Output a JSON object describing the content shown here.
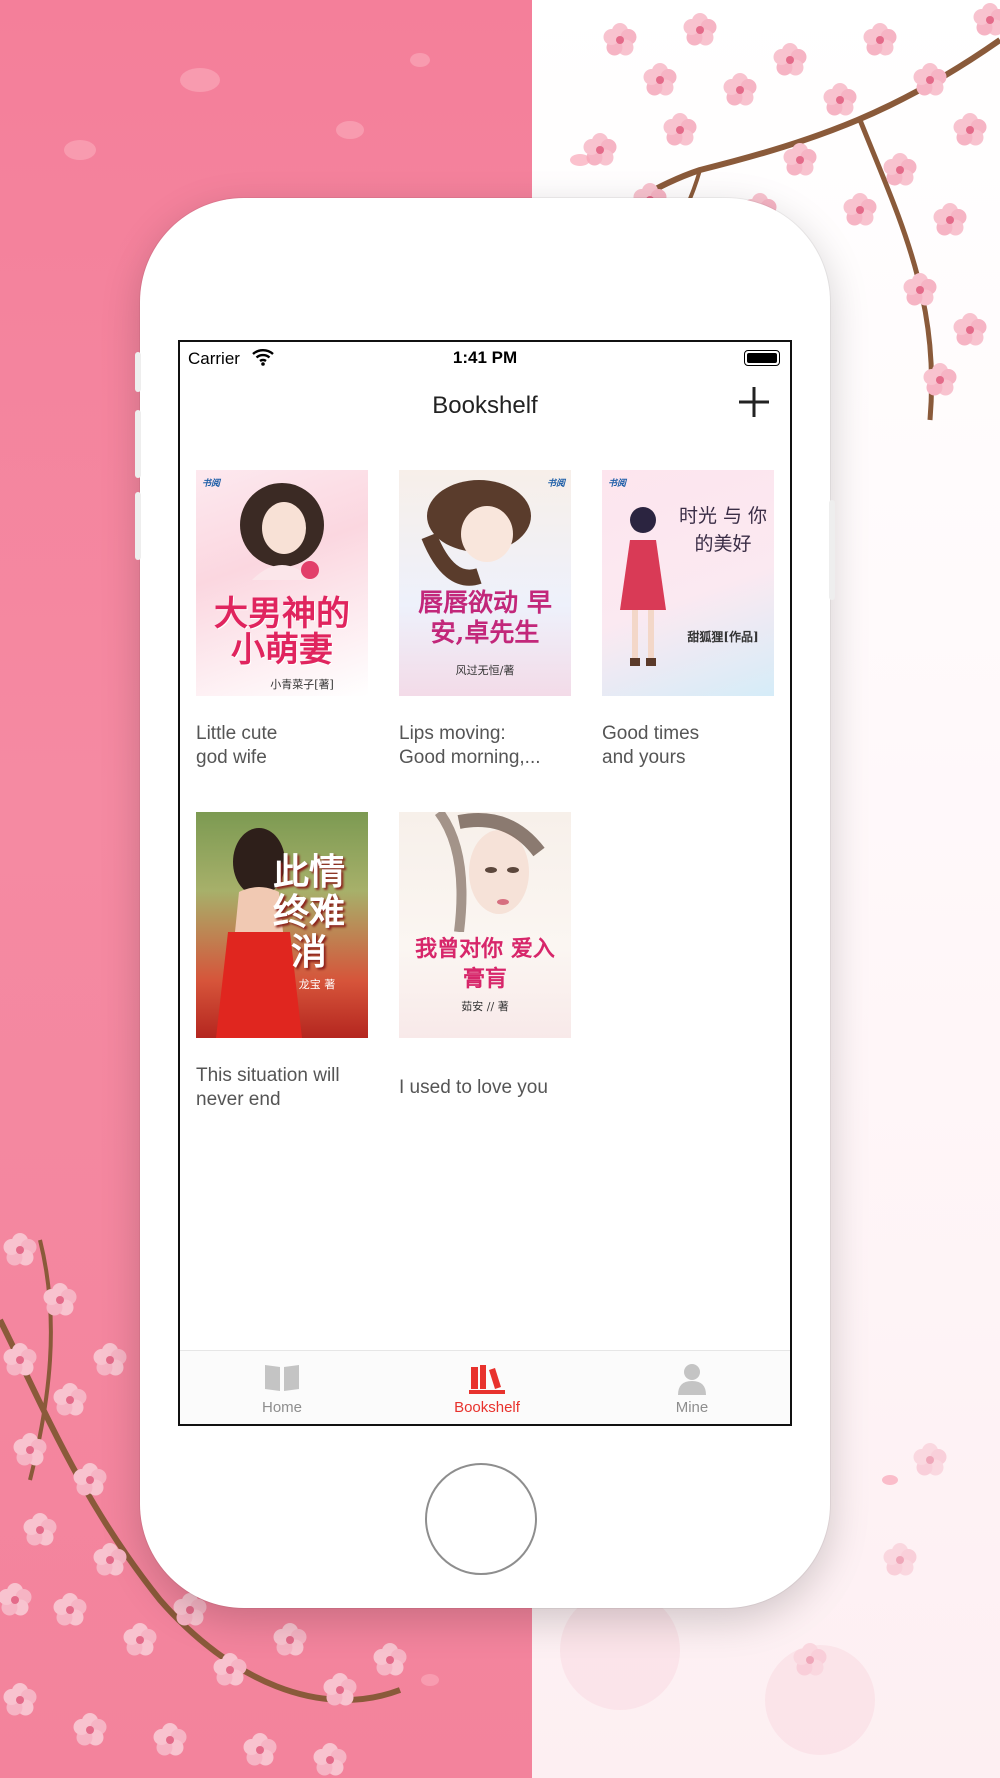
{
  "status_bar": {
    "carrier": "Carrier",
    "time": "1:41 PM"
  },
  "nav": {
    "title": "Bookshelf",
    "add_icon": "plus-icon"
  },
  "books": [
    {
      "title": "Little cute\ngod wife",
      "cover_title": "大男神的小萌妻",
      "cover_author": "小青菜子[著]",
      "publisher": "书阅"
    },
    {
      "title": "Lips moving:\nGood morning,...",
      "cover_title": "唇唇欲动 早安,卓先生",
      "cover_author": "风过无恒/著",
      "publisher": "书阅"
    },
    {
      "title": "Good times\nand yours",
      "cover_title": "时光 与 你的美好",
      "cover_author": "甜狐狸[作品]",
      "publisher": "书阅"
    },
    {
      "title": "This situation will\nnever end",
      "cover_title": "此情终难消",
      "cover_author": "龙宝 著",
      "publisher": ""
    },
    {
      "title": "I used to love you",
      "cover_title": "我曾对你 爱入膏肓",
      "cover_author": "茹安 // 著",
      "publisher": ""
    }
  ],
  "tabs": [
    {
      "label": "Home",
      "icon": "book-open-icon",
      "active": false
    },
    {
      "label": "Bookshelf",
      "icon": "bookshelf-icon",
      "active": true
    },
    {
      "label": "Mine",
      "icon": "person-icon",
      "active": false
    }
  ],
  "colors": {
    "accent": "#e8322d",
    "inactive": "#8e8e8e",
    "background_pink": "#f47f9a",
    "blossom": "#f7b3c2"
  }
}
